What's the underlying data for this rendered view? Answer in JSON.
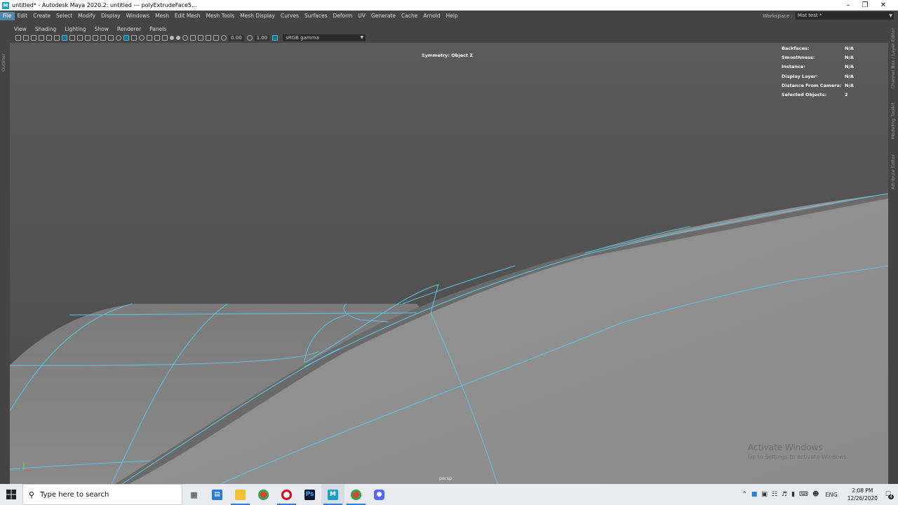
{
  "window": {
    "app_icon": "M",
    "title": "untitled* - Autodesk Maya 2020.2: untitled   ---   polyExtrudeFace5..."
  },
  "menubar": {
    "items": [
      "File",
      "Edit",
      "Create",
      "Select",
      "Modify",
      "Display",
      "Windows",
      "Mesh",
      "Edit Mesh",
      "Mesh Tools",
      "Mesh Display",
      "Curves",
      "Surfaces",
      "Deform",
      "UV",
      "Generate",
      "Cache",
      "Arnold",
      "Help"
    ],
    "active": "File"
  },
  "workspace": {
    "label": "Workspace :",
    "value": "Mat test *"
  },
  "left_tabs": [
    "Outliner"
  ],
  "right_tabs": [
    "Channel Box / Layer Editor",
    "Modeling Toolkit",
    "Attribute Editor"
  ],
  "panel_menu": [
    "View",
    "Shading",
    "Lighting",
    "Show",
    "Renderer",
    "Panels"
  ],
  "viewport_toolbar": {
    "exposure_value": "0.00",
    "gamma_value": "1.00",
    "color_space": "sRGB gamma"
  },
  "viewport": {
    "symmetry": "Symmetry: Object Z",
    "hud": [
      {
        "key": "Backfaces:",
        "value": "N/A"
      },
      {
        "key": "Smoothness:",
        "value": "N/A"
      },
      {
        "key": "Instance:",
        "value": "N/A"
      },
      {
        "key": "Display Layer:",
        "value": "N/A"
      },
      {
        "key": "Distance From Camera:",
        "value": "N/A"
      },
      {
        "key": "Selected Objects:",
        "value": "2"
      }
    ],
    "camera": "persp",
    "watermark_line1": "Activate Windows",
    "watermark_line2": "Go to Settings to activate Windows.",
    "wire_color": "#5bc8e8"
  },
  "taskbar": {
    "search_placeholder": "Type here to search",
    "apps": [
      "task-view-icon",
      "network-app-icon",
      "file-explorer-icon",
      "chrome-icon",
      "opera-icon",
      "photoshop-icon",
      "maya-icon",
      "chrome-alt-icon",
      "discord-icon"
    ],
    "language": "ENG",
    "time": "2:08 PM",
    "date": "12/26/2020",
    "notification_count": "4"
  }
}
